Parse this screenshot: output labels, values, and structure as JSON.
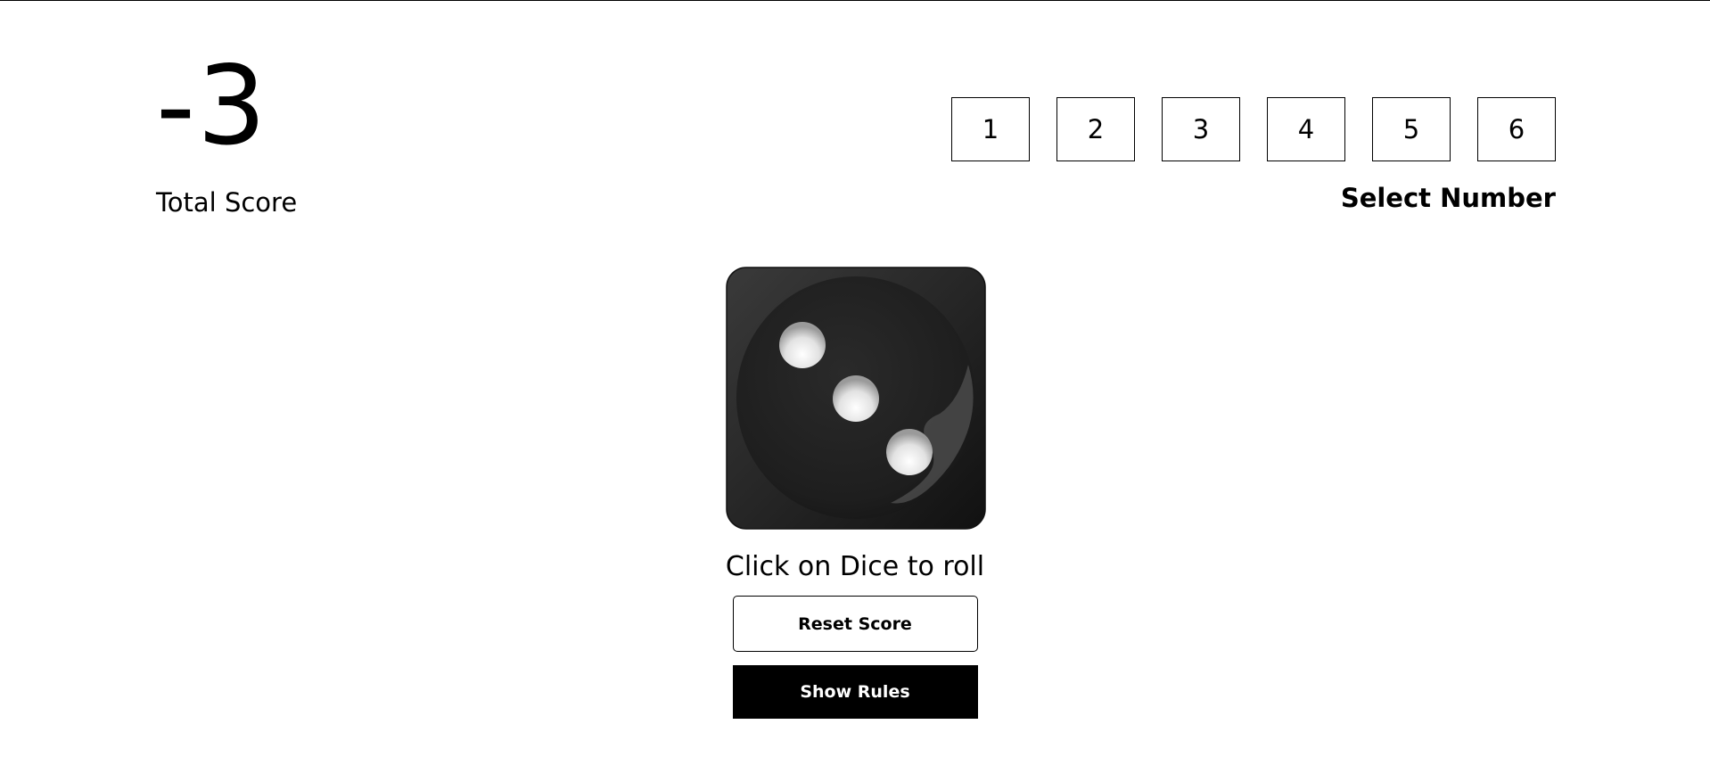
{
  "score": {
    "value": "-3",
    "label": "Total Score"
  },
  "selector": {
    "numbers": [
      "1",
      "2",
      "3",
      "4",
      "5",
      "6"
    ],
    "label": "Select Number"
  },
  "dice": {
    "face_value": 3,
    "icon": "dice-three-icon",
    "body_color": "#222222",
    "pip_color": "#f2f2f2"
  },
  "hint": "Click on Dice to roll",
  "buttons": {
    "reset_label": "Reset Score",
    "rules_label": "Show Rules"
  }
}
